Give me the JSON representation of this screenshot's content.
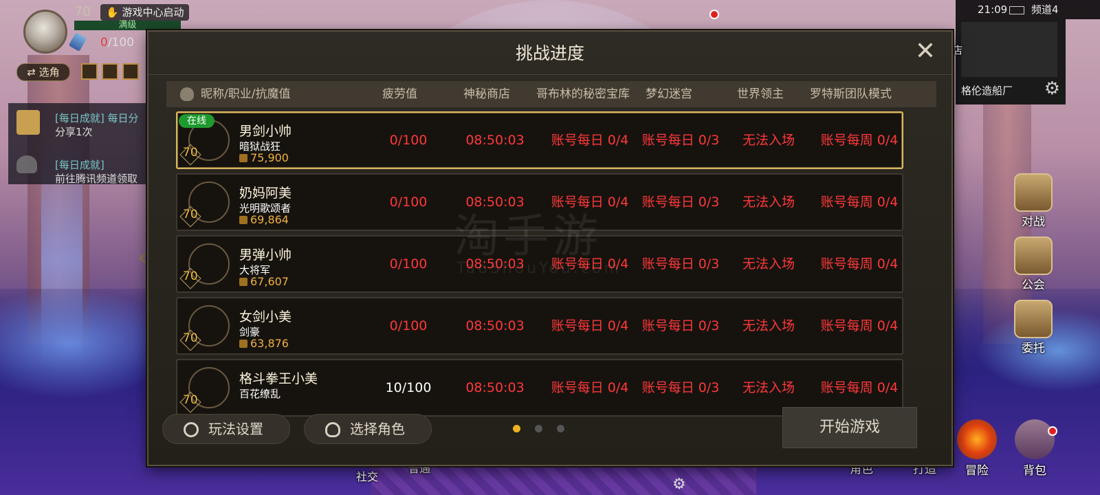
{
  "hud": {
    "level": "70",
    "launch_label": "游戏中心启动",
    "full_label": "满级",
    "fatigue_zero": "0",
    "fatigue_rest": "/100",
    "swap_label": "⇄ 选角",
    "quests": [
      {
        "title": "[每日成就] 每日分",
        "sub": "分享1次"
      },
      {
        "title": "[每日成就]",
        "sub": "前往腾讯频道领取"
      }
    ]
  },
  "status_bar": {
    "time": "21:09",
    "channel": "频道4"
  },
  "minimap": {
    "location": "格伦造船厂"
  },
  "side_buttons": [
    "对战",
    "公会",
    "委托"
  ],
  "bottom_buttons": [
    "角色",
    "打造",
    "冒险",
    "背包"
  ],
  "bottom_misc": {
    "social": "社交",
    "mode": "普通",
    "shop_fragment": "商店"
  },
  "dialog": {
    "title": "挑战进度",
    "close_symbol": "✕",
    "headers": [
      "昵称/职业/抗魔值",
      "疲劳值",
      "神秘商店",
      "哥布林的秘密宝库",
      "梦幻迷宫",
      "世界领主",
      "罗特斯团队模式"
    ],
    "online_label": "在线",
    "rows": [
      {
        "name": "男剑小帅",
        "job": "暗狱战狂",
        "power": "75,900",
        "level": "70",
        "fatigue": "0/100",
        "shop": "08:50:03",
        "goblin": "账号每日 0/4",
        "maze": "账号每日 0/3",
        "lord": "无法入场",
        "rotes": "账号每周 0/4",
        "portrait_color": "#d8cfc0"
      },
      {
        "name": "奶妈阿美",
        "job": "光明歌颂者",
        "power": "69,864",
        "level": "70",
        "fatigue": "0/100",
        "shop": "08:50:03",
        "goblin": "账号每日 0/4",
        "maze": "账号每日 0/3",
        "lord": "无法入场",
        "rotes": "账号每周 0/4",
        "portrait_color": "#c88a70"
      },
      {
        "name": "男弹小帅",
        "job": "大将军",
        "power": "67,607",
        "level": "70",
        "fatigue": "0/100",
        "shop": "08:50:03",
        "goblin": "账号每日 0/4",
        "maze": "账号每日 0/3",
        "lord": "无法入场",
        "rotes": "账号每周 0/4",
        "portrait_color": "#b88a6a"
      },
      {
        "name": "女剑小美",
        "job": "剑豪",
        "power": "63,876",
        "level": "70",
        "fatigue": "0/100",
        "shop": "08:50:03",
        "goblin": "账号每日 0/4",
        "maze": "账号每日 0/3",
        "lord": "无法入场",
        "rotes": "账号每周 0/4",
        "portrait_color": "#e0c8c0"
      },
      {
        "name": "格斗拳王小美",
        "job": "百花缭乱",
        "power": "",
        "level": "70",
        "fatigue": "10/100",
        "shop": "08:50:03",
        "goblin": "账号每日 0/4",
        "maze": "账号每日 0/3",
        "lord": "无法入场",
        "rotes": "账号每周 0/4",
        "portrait_color": "#c8906a"
      }
    ],
    "play_settings": "玩法设置",
    "select_role": "选择角色",
    "start_game": "开始游戏",
    "page_index": 1,
    "page_count": 3
  },
  "watermark": {
    "main": "淘手游",
    "sub": "TaoShouYou.com"
  }
}
